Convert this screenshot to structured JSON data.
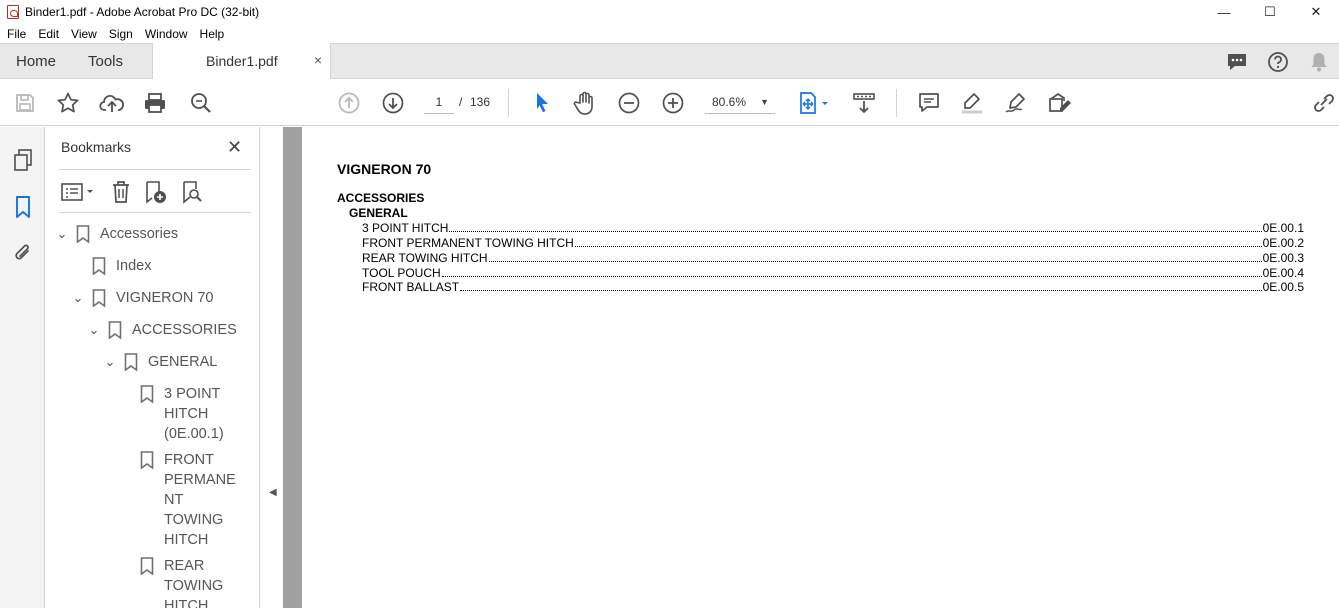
{
  "window": {
    "title": "Binder1.pdf - Adobe Acrobat Pro DC (32-bit)",
    "controls": [
      "—",
      "☐",
      "✕"
    ]
  },
  "menu": [
    "File",
    "Edit",
    "View",
    "Sign",
    "Window",
    "Help"
  ],
  "tabs": {
    "home": "Home",
    "tools": "Tools",
    "document": "Binder1.pdf",
    "close": "×"
  },
  "toolbar": {
    "page_current": "1",
    "page_separator": "/",
    "page_total": "136",
    "zoom": "80.6%",
    "zoom_caret": "▼"
  },
  "bookmarks": {
    "title": "Bookmarks",
    "close": "✕",
    "items": [
      {
        "label": "Accessories",
        "expanded": true
      },
      {
        "label": "Index"
      },
      {
        "label": "VIGNERON 70",
        "expanded": true
      },
      {
        "label": "ACCESSORIES",
        "expanded": true
      },
      {
        "label": "GENERAL",
        "expanded": true
      },
      {
        "label": "3 POINT\nHITCH\n(0E.00.1)"
      },
      {
        "label": "FRONT\nPERMANE\nNT\nTOWING\nHITCH"
      },
      {
        "label": "REAR\nTOWING\nHITCH"
      }
    ]
  },
  "document": {
    "title": "VIGNERON 70",
    "section": "ACCESSORIES",
    "subsection": "GENERAL",
    "toc": [
      {
        "label": "3 POINT HITCH",
        "ref": "0E.00.1"
      },
      {
        "label": "FRONT PERMANENT TOWING HITCH",
        "ref": "0E.00.2"
      },
      {
        "label": "REAR TOWING HITCH",
        "ref": "0E.00.3"
      },
      {
        "label": "TOOL POUCH",
        "ref": "0E.00.4"
      },
      {
        "label": "FRONT BALLAST",
        "ref": "0E.00.5"
      }
    ]
  },
  "colors": {
    "accent_blue": "#1473e6",
    "icon_gray": "#505050",
    "pdf_red": "#c8271f"
  }
}
